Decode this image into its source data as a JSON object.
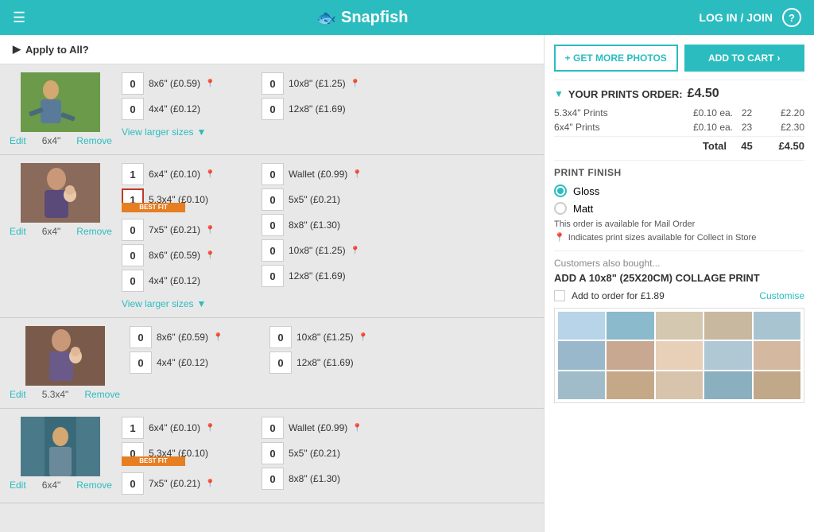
{
  "header": {
    "logo_text": "Snapfish",
    "login_text": "LOG IN / JOIN",
    "help_char": "?",
    "fish_unicode": "🐟"
  },
  "apply_all": {
    "label": "Apply to All?"
  },
  "actions": {
    "get_more_photos": "+ GET MORE PHOTOS",
    "add_to_cart": "ADD TO CART"
  },
  "order": {
    "title": "YOUR PRINTS ORDER:",
    "total_price": "£4.50",
    "rows": [
      {
        "label": "5.3x4\" Prints",
        "price_each": "£0.10 ea.",
        "qty": "22",
        "subtotal": "£2.20"
      },
      {
        "label": "6x4\" Prints",
        "price_each": "£0.10 ea.",
        "qty": "23",
        "subtotal": "£2.30"
      }
    ],
    "total_label": "Total",
    "total_qty": "45",
    "total_subtotal": "£4.50"
  },
  "print_finish": {
    "title": "PRINT FINISH",
    "options": [
      {
        "label": "Gloss",
        "selected": true
      },
      {
        "label": "Matt",
        "selected": false
      }
    ],
    "mail_order_note": "This order is available for Mail Order",
    "collect_note": "Indicates print sizes available for Collect in Store"
  },
  "customers": {
    "intro": "Customers also bought...",
    "collage_title": "ADD A 10x8\" (25X20CM) COLLAGE PRINT",
    "add_label": "Add to order for £1.89",
    "customise_label": "Customise"
  },
  "photos": [
    {
      "id": "photo1",
      "size_label": "6x4\"",
      "thumb_class": "photo-thumb-bg1",
      "sizes_col1": [
        {
          "qty": "0",
          "label": "8x6\" (£0.59)",
          "pin": true,
          "best_fit": false,
          "highlighted": false
        },
        {
          "qty": "0",
          "label": "4x4\" (£0.12)",
          "pin": false,
          "best_fit": false,
          "highlighted": false
        }
      ],
      "sizes_col2": [
        {
          "qty": "0",
          "label": "10x8\" (£1.25)",
          "pin": true,
          "best_fit": false,
          "highlighted": false
        },
        {
          "qty": "0",
          "label": "12x8\" (£1.69)",
          "pin": false,
          "best_fit": false,
          "highlighted": false
        }
      ]
    },
    {
      "id": "photo2",
      "size_label": "6x4\"",
      "thumb_class": "photo-thumb-bg2",
      "sizes_col1": [
        {
          "qty": "1",
          "label": "6x4\" (£0.10)",
          "pin": true,
          "best_fit": false,
          "highlighted": false
        },
        {
          "qty": "1",
          "label": "5.3x4\" (£0.10)",
          "pin": false,
          "best_fit": true,
          "highlighted": true
        },
        {
          "qty": "0",
          "label": "7x5\" (£0.21)",
          "pin": true,
          "best_fit": false,
          "highlighted": false
        },
        {
          "qty": "0",
          "label": "8x6\" (£0.59)",
          "pin": true,
          "best_fit": false,
          "highlighted": false
        },
        {
          "qty": "0",
          "label": "4x4\" (£0.12)",
          "pin": false,
          "best_fit": false,
          "highlighted": false
        }
      ],
      "sizes_col2": [
        {
          "qty": "0",
          "label": "Wallet (£0.99)",
          "pin": true,
          "best_fit": false,
          "highlighted": false
        },
        {
          "qty": "0",
          "label": "5x5\" (£0.21)",
          "pin": false,
          "best_fit": false,
          "highlighted": false
        },
        {
          "qty": "0",
          "label": "8x8\" (£1.30)",
          "pin": false,
          "best_fit": false,
          "highlighted": false
        },
        {
          "qty": "0",
          "label": "10x8\" (£1.25)",
          "pin": true,
          "best_fit": false,
          "highlighted": false
        },
        {
          "qty": "0",
          "label": "12x8\" (£1.69)",
          "pin": false,
          "best_fit": false,
          "highlighted": false
        }
      ]
    },
    {
      "id": "photo3",
      "size_label": "5.3x4\"",
      "thumb_class": "photo-thumb-bg2",
      "sizes_col1": [
        {
          "qty": "0",
          "label": "8x6\" (£0.59)",
          "pin": true,
          "best_fit": false,
          "highlighted": false
        },
        {
          "qty": "0",
          "label": "4x4\" (£0.12)",
          "pin": false,
          "best_fit": false,
          "highlighted": false
        }
      ],
      "sizes_col2": [
        {
          "qty": "0",
          "label": "10x8\" (£1.25)",
          "pin": true,
          "best_fit": false,
          "highlighted": false
        },
        {
          "qty": "0",
          "label": "12x8\" (£1.69)",
          "pin": false,
          "best_fit": false,
          "highlighted": false
        }
      ]
    },
    {
      "id": "photo4",
      "size_label": "6x4\"",
      "thumb_class": "photo-thumb-bg3",
      "sizes_col1": [
        {
          "qty": "1",
          "label": "6x4\" (£0.10)",
          "pin": true,
          "best_fit": false,
          "highlighted": false
        },
        {
          "qty": "0",
          "label": "5.3x4\" (£0.10)",
          "pin": false,
          "best_fit": true,
          "highlighted": false
        },
        {
          "qty": "0",
          "label": "7x5\" (£0.21)",
          "pin": true,
          "best_fit": false,
          "highlighted": false
        }
      ],
      "sizes_col2": [
        {
          "qty": "0",
          "label": "Wallet (£0.99)",
          "pin": true,
          "best_fit": false,
          "highlighted": false
        },
        {
          "qty": "0",
          "label": "5x5\" (£0.21)",
          "pin": false,
          "best_fit": false,
          "highlighted": false
        },
        {
          "qty": "0",
          "label": "8x8\" (£1.30)",
          "pin": false,
          "best_fit": false,
          "highlighted": false
        }
      ]
    }
  ]
}
